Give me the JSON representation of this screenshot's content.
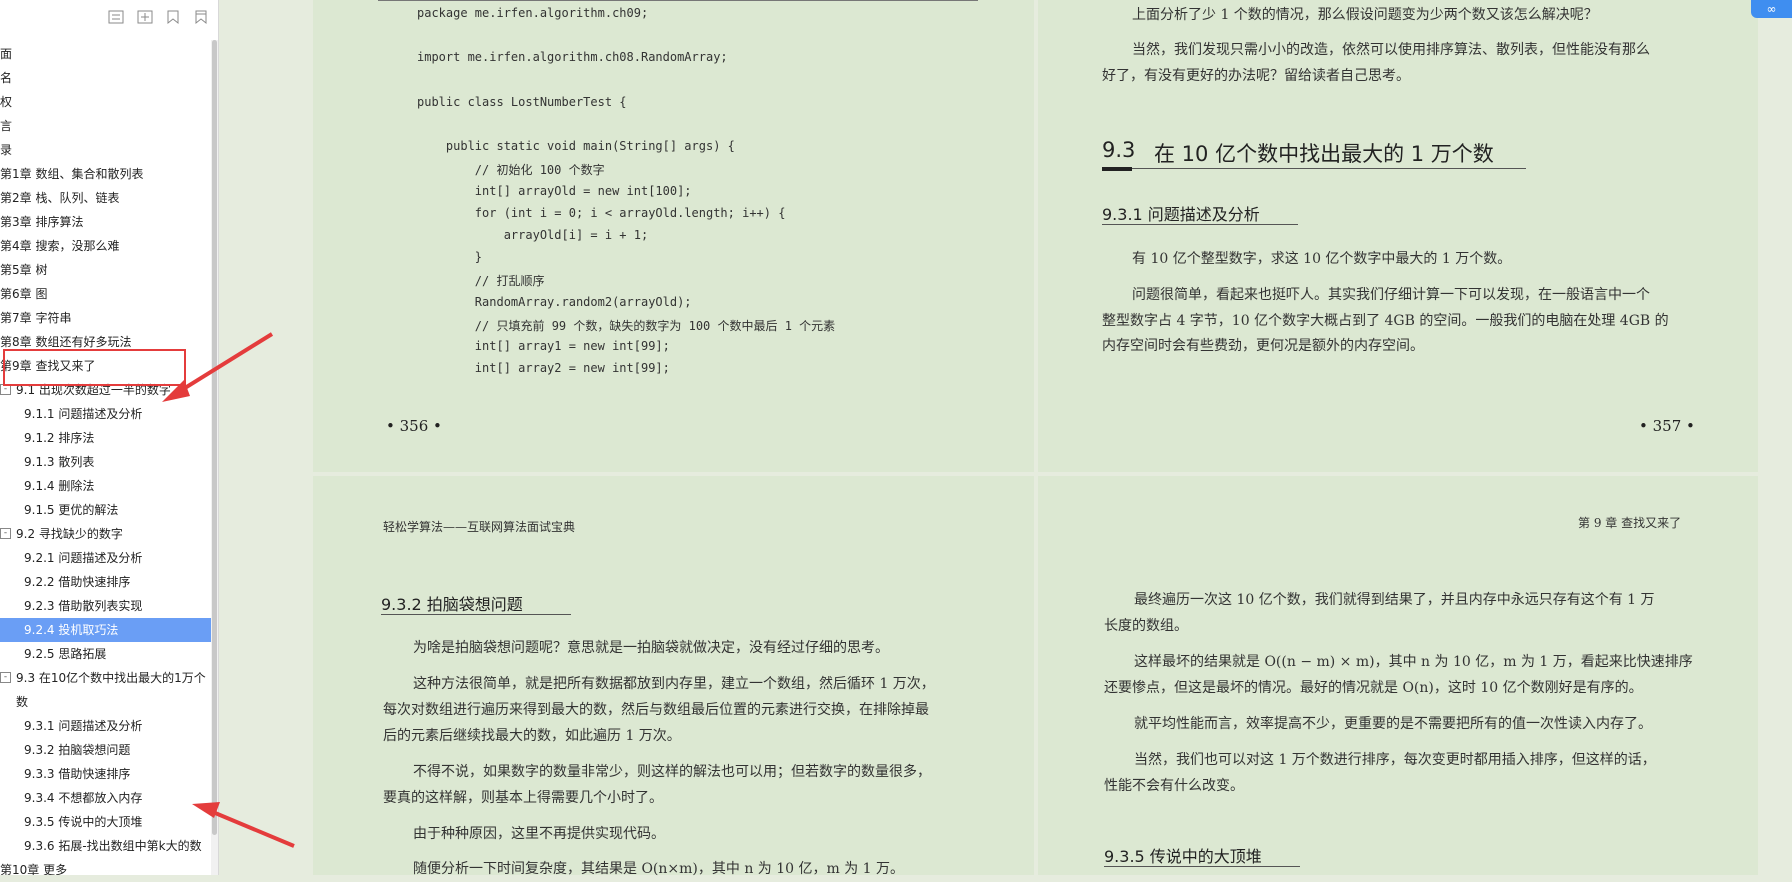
{
  "toolbar": {
    "icons": [
      "collapse-all-icon",
      "expand-all-icon",
      "add-bookmark-icon",
      "bookmark-icon"
    ]
  },
  "toc": [
    {
      "label": "面"
    },
    {
      "label": "名"
    },
    {
      "label": "权"
    },
    {
      "label": "言"
    },
    {
      "label": "录"
    },
    {
      "label": "第1章 数组、集合和散列表"
    },
    {
      "label": "第2章 栈、队列、链表"
    },
    {
      "label": "第3章 排序算法"
    },
    {
      "label": "第4章 搜索，没那么难"
    },
    {
      "label": "第5章 树"
    },
    {
      "label": "第6章 图"
    },
    {
      "label": "第7章 字符串"
    },
    {
      "label": "第8章 数组还有好多玩法"
    },
    {
      "label": "第9章 查找又来了"
    },
    {
      "label": "9.1 出现次数超过一半的数字",
      "toggle": "-"
    },
    {
      "label": "9.1.1 问题描述及分析"
    },
    {
      "label": "9.1.2 排序法"
    },
    {
      "label": "9.1.3 散列表"
    },
    {
      "label": "9.1.4 删除法"
    },
    {
      "label": "9.1.5 更优的解法"
    },
    {
      "label": "9.2 寻找缺少的数字",
      "toggle": "-"
    },
    {
      "label": "9.2.1 问题描述及分析"
    },
    {
      "label": "9.2.2 借助快速排序"
    },
    {
      "label": "9.2.3 借助散列表实现"
    },
    {
      "label": "9.2.4 投机取巧法"
    },
    {
      "label": "9.2.5 思路拓展"
    },
    {
      "label": "9.3 在10亿个数中找出最大的1万个",
      "toggle": "-"
    },
    {
      "label": "数"
    },
    {
      "label": "9.3.1 问题描述及分析"
    },
    {
      "label": "9.3.2 拍脑袋想问题"
    },
    {
      "label": "9.3.3 借助快速排序"
    },
    {
      "label": "9.3.4 不想都放入内存"
    },
    {
      "label": "9.3.5 传说中的大顶堆"
    },
    {
      "label": "9.3.6 拓展-找出数组中第k大的数"
    },
    {
      "label": "第10章 更多"
    }
  ],
  "page356": {
    "code": [
      "package me.irfen.algorithm.ch09;",
      "",
      "import me.irfen.algorithm.ch08.RandomArray;",
      "",
      "public class LostNumberTest {",
      "",
      "    public static void main(String[] args) {",
      "        // 初始化 100 个数字",
      "        int[] arrayOld = new int[100];",
      "        for (int i = 0; i < arrayOld.length; i++) {",
      "            arrayOld[i] = i + 1;",
      "        }",
      "        // 打乱顺序",
      "        RandomArray.random2(arrayOld);",
      "        // 只填充前 99 个数，缺失的数字为 100 个数中最后 1 个元素",
      "        int[] array1 = new int[99];",
      "        int[] array2 = new int[99];"
    ],
    "page_number": "• 356 •"
  },
  "page357": {
    "p1": "上面分析了少 1 个数的情况，那么假设问题变为少两个数又该怎么解决呢？",
    "p2a": "当然，我们发现只需小小的改造，依然可以使用排序算法、散列表，但性能没有那么",
    "p2b": "好了，有没有更好的办法呢？留给读者自己思考。",
    "section_num": "9.3",
    "section_title": "在 10 亿个数中找出最大的 1 万个数",
    "subsection": "9.3.1   问题描述及分析",
    "p3": "有 10 亿个整型数字，求这 10 亿个数字中最大的 1 万个数。",
    "p4a": "问题很简单，看起来也挺吓人。其实我们仔细计算一下可以发现，在一般语言中一个",
    "p4b": "整型数字占 4 字节，10 亿个数字大概占到了 4GB 的空间。一般我们的电脑在处理 4GB 的",
    "p4c": "内存空间时会有些费劲，更何况是额外的内存空间。",
    "page_number": "• 357 •"
  },
  "page358": {
    "header": "轻松学算法——互联网算法面试宝典",
    "subsection": "9.3.2   拍脑袋想问题",
    "p1": "为啥是拍脑袋想问题呢？意思就是一拍脑袋就做决定，没有经过仔细的思考。",
    "p2a": "这种方法很简单，就是把所有数据都放到内存里，建立一个数组，然后循环 1 万次，",
    "p2b": "每次对数组进行遍历来得到最大的数，然后与数组最后位置的元素进行交换，在排除掉最",
    "p2c": "后的元素后继续找最大的数，如此遍历 1 万次。",
    "p3a": "不得不说，如果数字的数量非常少，则这样的解法也可以用；但若数字的数量很多，",
    "p3b": "要真的这样解，则基本上得需要几个小时了。",
    "p4": "由于种种原因，这里不再提供实现代码。",
    "p5": "随便分析一下时间复杂度，其结果是 O(n×m)，其中 n 为 10 亿，m 为 1 万。"
  },
  "page359": {
    "header": "第 9 章   查找又来了",
    "p1a": "最终遍历一次这 10 亿个数，我们就得到结果了，并且内存中永远只存有这个有 1 万",
    "p1b": "长度的数组。",
    "p2a": "这样最坏的结果就是 O((n − m) × m)，其中 n 为 10 亿，m 为 1 万，看起来比快速排序",
    "p2b": "还要惨点，但这是最坏的情况。最好的情况就是 O(n)，这时 10 亿个数刚好是有序的。",
    "p3": "就平均性能而言，效率提高不少，更重要的是不需要把所有的值一次性读入内存了。",
    "p4a": "当然，我们也可以对这 1 万个数进行排序，每次变更时都用插入排序，但这样的话，",
    "p4b": "性能不会有什么改变。",
    "subsection": "9.3.5   传说中的大顶堆"
  },
  "colors": {
    "page_bg": "#dce8d2",
    "active_item": "#6a9ef5",
    "annotation": "#e43c3c"
  }
}
